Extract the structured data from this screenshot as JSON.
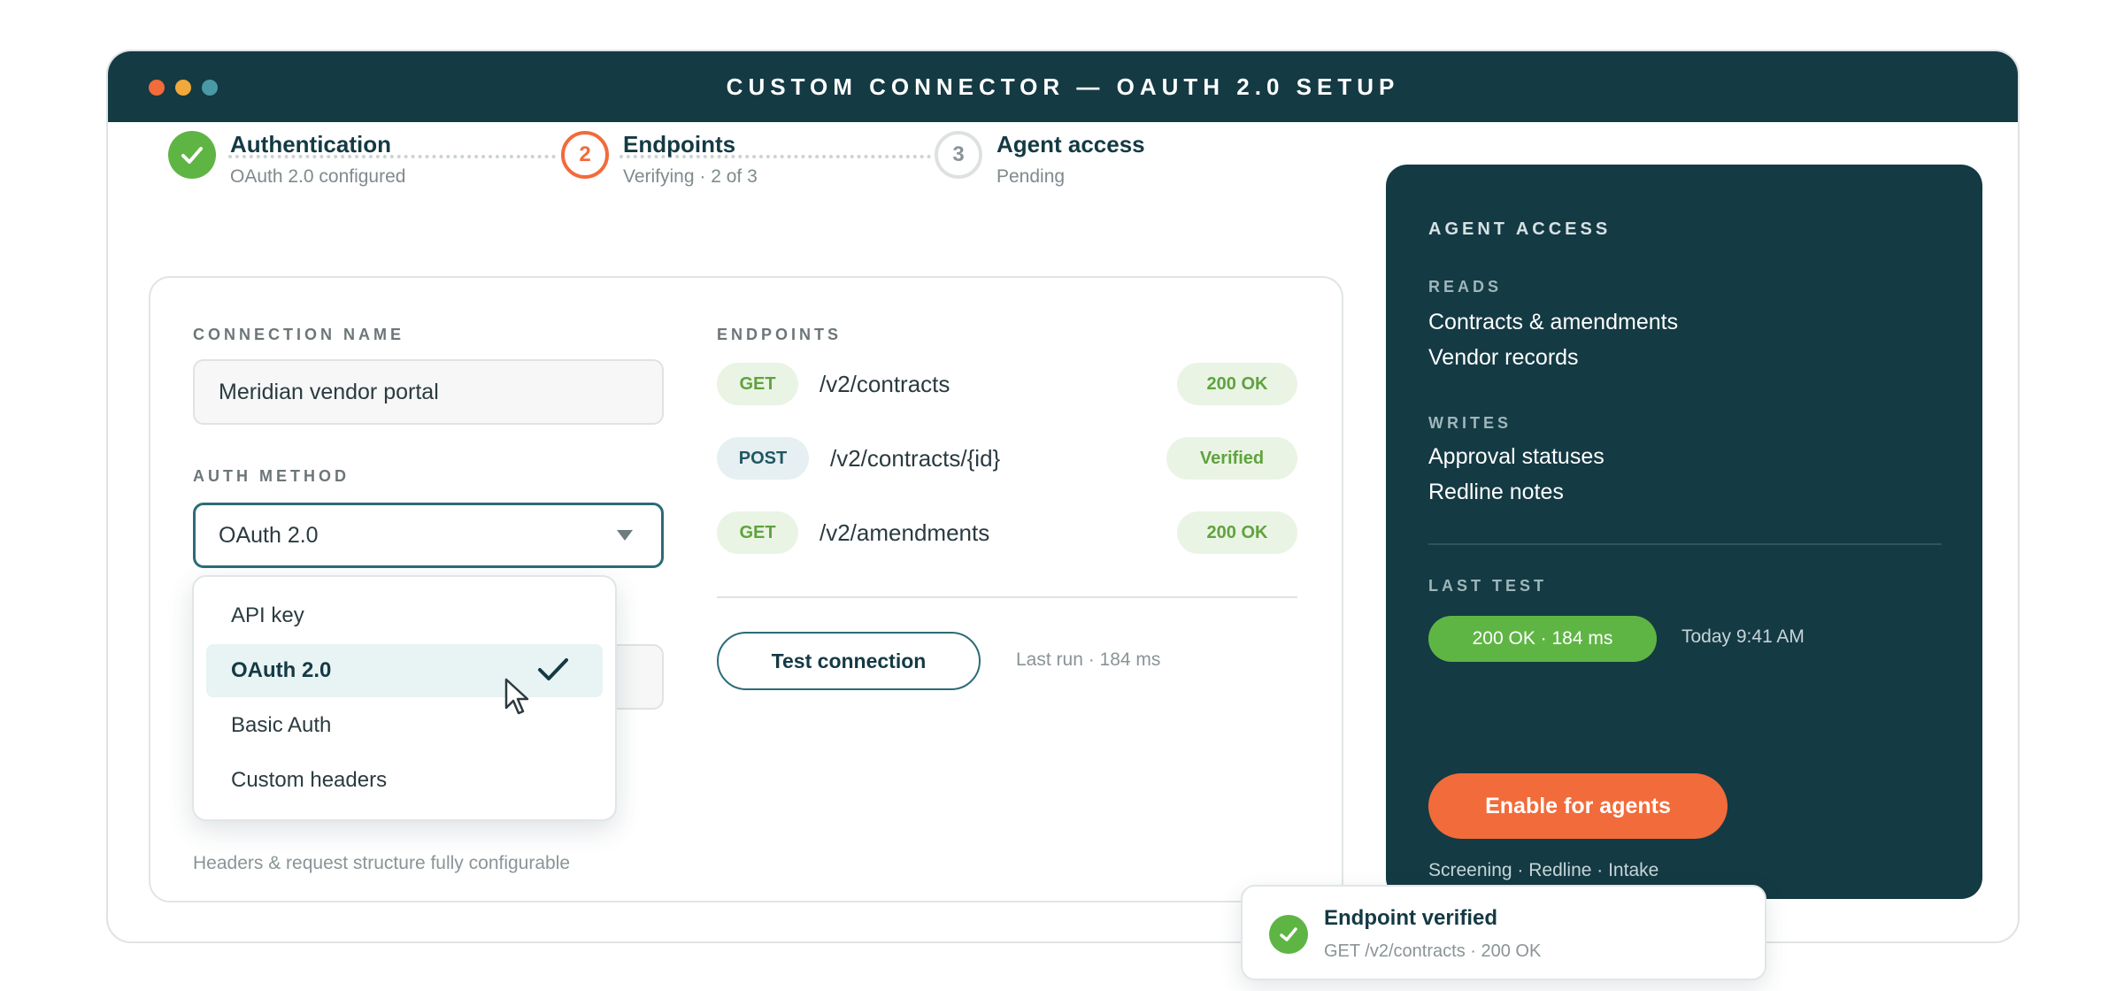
{
  "window": {
    "title": "CUSTOM CONNECTOR — OAUTH 2.0 SETUP"
  },
  "stepper": {
    "steps": [
      {
        "number": "",
        "title": "Authentication",
        "subtitle": "OAuth 2.0 configured",
        "state": "done"
      },
      {
        "number": "2",
        "title": "Endpoints",
        "subtitle": "Verifying · 2 of 3",
        "state": "active"
      },
      {
        "number": "3",
        "title": "Agent access",
        "subtitle": "Pending",
        "state": "pending"
      }
    ]
  },
  "form": {
    "connection_name_label": "CONNECTION NAME",
    "connection_name_value": "Meridian vendor portal",
    "auth_method_label": "AUTH METHOD",
    "auth_method_value": "OAuth 2.0",
    "auth_options": [
      "API key",
      "OAuth 2.0",
      "Basic Auth",
      "Custom headers"
    ],
    "selected_option_index": 1,
    "footnote": "Headers & request structure fully configurable"
  },
  "endpoints": {
    "label": "ENDPOINTS",
    "rows": [
      {
        "method": "GET",
        "path": "/v2/contracts",
        "status": "200 OK"
      },
      {
        "method": "POST",
        "path": "/v2/contracts/{id}",
        "status": "Verified"
      },
      {
        "method": "GET",
        "path": "/v2/amendments",
        "status": "200 OK"
      }
    ],
    "test_button": "Test connection",
    "last_run": "Last run · 184 ms"
  },
  "agent_access": {
    "heading": "AGENT ACCESS",
    "reads_label": "READS",
    "reads": [
      "Contracts & amendments",
      "Vendor records"
    ],
    "writes_label": "WRITES",
    "writes": [
      "Approval statuses",
      "Redline notes"
    ],
    "last_test_label": "LAST TEST",
    "last_test_status": "200 OK · 184 ms",
    "last_test_time": "Today 9:41 AM",
    "enable_button": "Enable for agents",
    "caption": "Screening · Redline · Intake"
  },
  "toast": {
    "title": "Endpoint verified",
    "subtitle": "GET /v2/contracts · 200 OK"
  },
  "colors": {
    "navy": "#143a44",
    "accent_orange": "#f26b3a",
    "success_green": "#5fb544",
    "teal_border": "#2b6c77"
  },
  "icons": {
    "step1": "check-icon",
    "dropdown": "chevron-down-icon",
    "selected": "check-icon",
    "pointer": "mouse-cursor-icon",
    "toast": "check-circle-icon"
  }
}
